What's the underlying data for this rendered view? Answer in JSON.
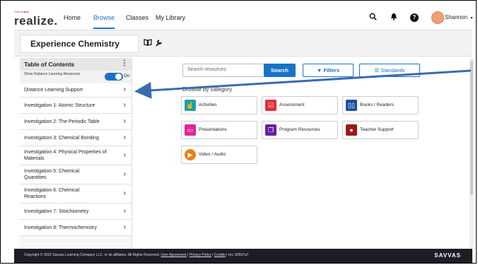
{
  "nav": {
    "logo_small": "SAVVAS",
    "logo_main": "realize.",
    "links": [
      "Home",
      "Browse",
      "Classes",
      "My Library"
    ],
    "active": "Browse",
    "user_name": "Shannon"
  },
  "header": {
    "title": "Experience Chemistry"
  },
  "toc": {
    "title": "Table of Contents",
    "toggle_label": "Show Distance Learning Resources",
    "toggle_state": "On",
    "items": [
      "Distance Learning Support",
      "Investigation 1: Atomic Structure",
      "Investigation 2: The Periodic Table",
      "Investigation 3: Chemical Bonding",
      "Investigation 4: Physical Properties of Materials",
      "Investigation 5: Chemical Quantities",
      "Investigation 6: Chemical Reactions",
      "Investigation 7: Stoichiometry",
      "Investigation 8: Thermochemistry"
    ]
  },
  "main": {
    "search_placeholder": "Search resources",
    "search_button": "Search",
    "filters_button": "Filters",
    "standards_button": "Standards",
    "category_heading": "Browse by category",
    "categories": [
      {
        "label": "Activities",
        "color": "#17a2a8",
        "icon": "hand-pointer-icon"
      },
      {
        "label": "Assessment",
        "color": "#e0303a",
        "icon": "checkbox-icon"
      },
      {
        "label": "Books / Readers",
        "color": "#1f4fa0",
        "icon": "book-icon"
      },
      {
        "label": "Presentations",
        "color": "#e0259a",
        "icon": "presentation-icon"
      },
      {
        "label": "Program Resources",
        "color": "#6a1fa0",
        "icon": "copy-icon"
      },
      {
        "label": "Teacher Support",
        "color": "#9a1a1a",
        "icon": "apple-icon"
      },
      {
        "label": "Video / Audio",
        "color": "#f07f15",
        "icon": "play-icon"
      }
    ]
  },
  "footer": {
    "copyright": "Copyright © 2022 Savvas Learning Company LLC. or its affiliates. All Rights Reserved.",
    "user_agreement": "User Agreement",
    "privacy_policy": "Privacy Policy",
    "credits": "Credits",
    "revision": "rev. 82667a7",
    "brand": "SAVVAS"
  }
}
